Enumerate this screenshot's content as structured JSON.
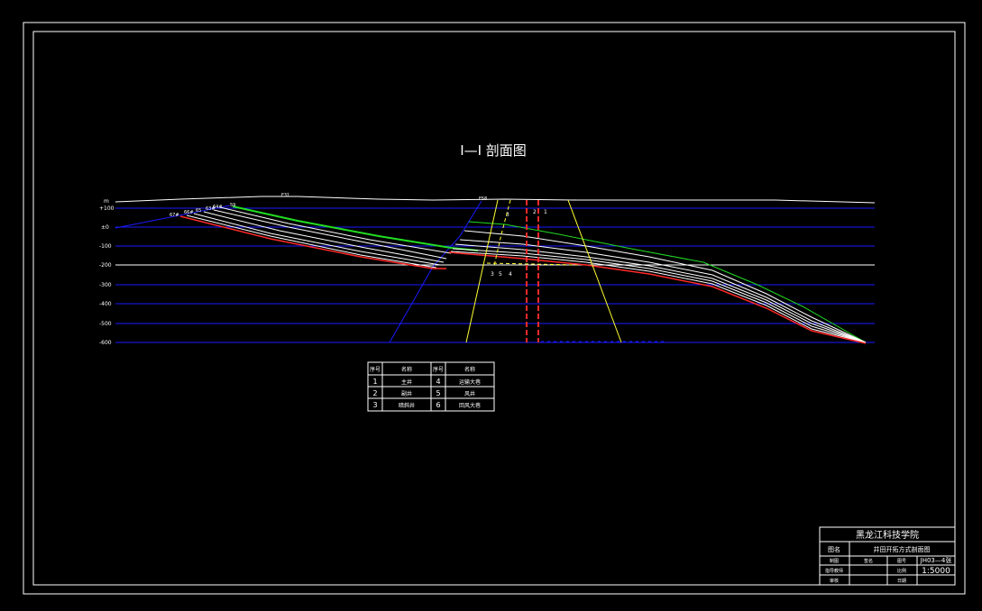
{
  "drawing": {
    "title": "Ⅰ—Ⅰ  剖面图",
    "elevations": [
      "+100",
      "±0",
      "-100",
      "-200",
      "-300",
      "-400",
      "-500",
      "-600"
    ],
    "top_mark": "m",
    "fault_labels": [
      "F31",
      "F58"
    ],
    "seam_labels": [
      "67#",
      "66#",
      "65",
      "63#",
      "64#",
      "59"
    ],
    "shaft_labels": [
      "3",
      "2",
      "1"
    ],
    "bottom_labels": [
      "3",
      "5",
      "4"
    ],
    "colors": {
      "background": "#000000",
      "frame": "#ffffff",
      "level_lines": "#1a1aff",
      "seam_top": "#22dd22",
      "seam_bottom": "#ff2a2a",
      "pit_outline": "#ffff33",
      "shafts": "#ff2a2a"
    }
  },
  "legend": {
    "headers": [
      "序号",
      "名称",
      "序号",
      "名称"
    ],
    "rows": [
      [
        "1",
        "主井",
        "4",
        "运输大巷"
      ],
      [
        "2",
        "副井",
        "5",
        "风井"
      ],
      [
        "3",
        "暗斜井",
        "6",
        "回风大巷"
      ]
    ]
  },
  "title_block": {
    "school": "黑龙江科技学院",
    "drawing_label": "图名",
    "drawing_name": "井田开拓方式剖面图",
    "r1": [
      "制图",
      "签名",
      "图号",
      "JH03—4张"
    ],
    "r2": [
      "指导教师",
      "",
      "比例",
      "1:5000"
    ],
    "r3": [
      "审核",
      "",
      "日期",
      ""
    ]
  }
}
